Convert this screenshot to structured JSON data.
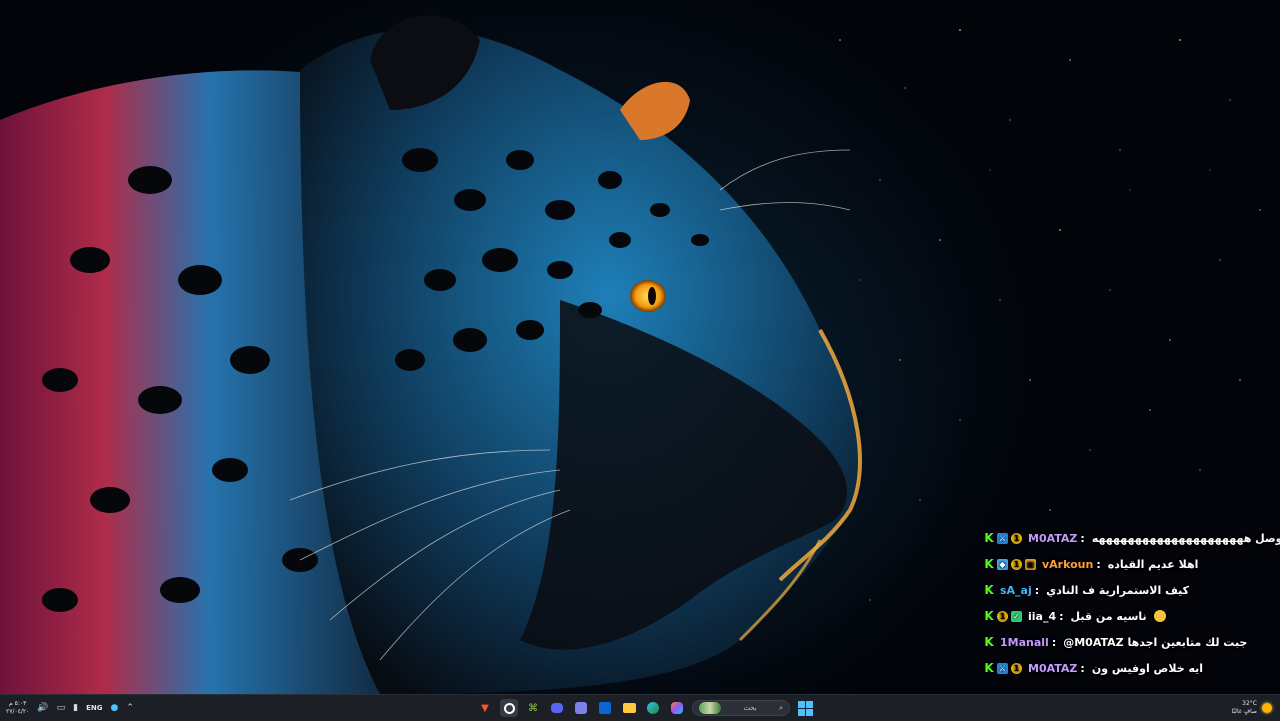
{
  "chat": {
    "messages": [
      {
        "user": "M0ATAZ",
        "user_color": "#c39bff",
        "text": "ما توصل هههههههههههههههههههههه",
        "badges": [
          "kick",
          "blue",
          "gold"
        ]
      },
      {
        "user": "vArkoun",
        "user_color": "#ff9c3a",
        "text": "اهلا عديم القياده",
        "badges": [
          "kick",
          "cube",
          "gold",
          "box"
        ]
      },
      {
        "user": "sA_aj",
        "user_color": "#41b4ff",
        "text": "كيف الاستمرارية ف النادي",
        "badges": [
          "kick"
        ]
      },
      {
        "user": "iia_4",
        "user_color": "#ffffff",
        "text": "ناسيه من قبل",
        "badges": [
          "kick",
          "gold",
          "green"
        ],
        "emoji": "laughing-emoji"
      },
      {
        "user": "1Manall",
        "user_color": "#c39bff",
        "text": "@M0ATAZ جبت لك متابعين اجدها",
        "badges": [
          "kick"
        ]
      },
      {
        "user": "M0ATAZ",
        "user_color": "#c39bff",
        "text": "ايه خلاص اوفيس ون",
        "badges": [
          "kick",
          "blue",
          "gold"
        ]
      }
    ]
  },
  "taskbar": {
    "clock_time": "٥:٠٣ م",
    "clock_date": "٢٧/٠٤/٢٠",
    "language": "ENG",
    "search_placeholder": "بحث",
    "weather_temp": "32°C",
    "weather_desc": "صافٍ غالبًا",
    "apps": [
      "brave-browser-icon",
      "obs-icon",
      "discord-icon",
      "teams-icon",
      "outlook-icon",
      "file-explorer-icon",
      "edge-icon",
      "copilot-icon"
    ]
  },
  "colors": {
    "kick_green": "#53fc18",
    "taskbar_bg": "#1c1f26",
    "windows_blue": "#4cc2ff"
  }
}
